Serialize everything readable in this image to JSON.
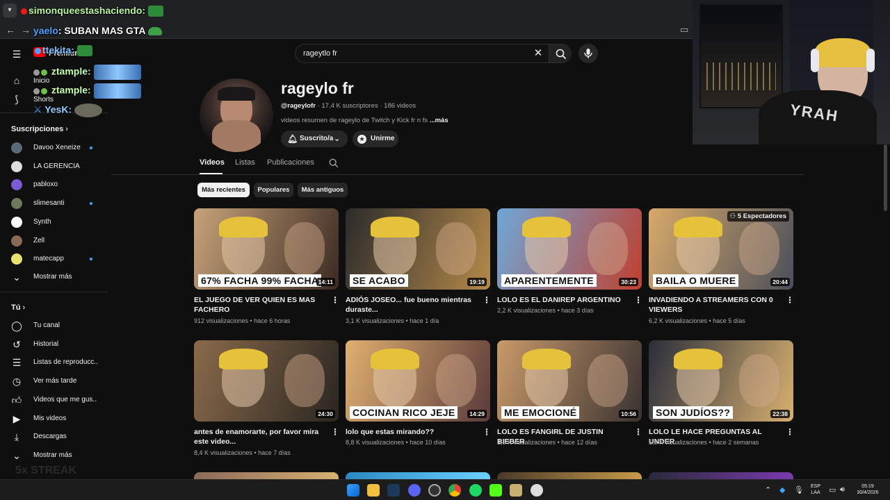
{
  "browser": {
    "tab_dropdown_icon": "chevron-down-icon"
  },
  "chat": [
    {
      "user": "simonqueestashaciendo:",
      "msg": "",
      "color": "#b9f5a0"
    },
    {
      "user": "yaelo",
      "msg": ": SUBAN MAS GTA",
      "color": "#4fa3ff"
    },
    {
      "user": "ttekita:",
      "msg": "",
      "color": "#7fc2ff"
    },
    {
      "user": "ztample:",
      "msg": "",
      "color": "#c8ffb0"
    },
    {
      "user": "ztample:",
      "msg": "",
      "color": "#c8ffb0"
    },
    {
      "user": "YesK:",
      "msg": "",
      "color": "#8fd0ff"
    }
  ],
  "masthead": {
    "premium_label": "Premium",
    "search_value": "rageytlo fr"
  },
  "guide": {
    "main": [
      {
        "label": "Inicio",
        "icon": "home-icon"
      },
      {
        "label": "Shorts",
        "icon": "shorts-icon"
      }
    ],
    "subs_header": "Suscripciones",
    "subscriptions": [
      {
        "label": "Davoo Xeneize",
        "dot": true,
        "color": "#5a6a7a"
      },
      {
        "label": "LA GERENCIA",
        "dot": false,
        "color": "#dddddd"
      },
      {
        "label": "pabloxo",
        "dot": false,
        "color": "#7b5cd6"
      },
      {
        "label": "slimesanti",
        "dot": true,
        "color": "#6b7a5a"
      },
      {
        "label": "Synth",
        "dot": false,
        "color": "#ffffff"
      },
      {
        "label": "Zell",
        "dot": false,
        "color": "#8a6a55"
      },
      {
        "label": "matecapp",
        "dot": true,
        "color": "#e8e070"
      }
    ],
    "subs_more": "Mostrar más",
    "you_header": "Tú",
    "you_items": [
      {
        "label": "Tu canal",
        "icon": "user-icon"
      },
      {
        "label": "Historial",
        "icon": "history-icon"
      },
      {
        "label": "Listas de reproducc...",
        "icon": "playlist-icon"
      },
      {
        "label": "Ver más tarde",
        "icon": "clock-icon"
      },
      {
        "label": "Videos que me gus...",
        "icon": "thumbs-up-icon"
      },
      {
        "label": "Mis videos",
        "icon": "video-icon"
      },
      {
        "label": "Descargas",
        "icon": "download-icon"
      }
    ],
    "you_more": "Mostrar más",
    "streak_text": "5x STREAK"
  },
  "channel": {
    "name": "rageylo fr",
    "handle": "@rageylofr",
    "subscribers": "17,4 K suscriptores",
    "videos_count": "186 videos",
    "description": "videos resumen de rageylo de Twitch y Kick fr n fs",
    "more_link": "...más",
    "subscribed_label": "Suscrito/a",
    "join_label": "Unirme"
  },
  "tabs": [
    "Videos",
    "Listas",
    "Publicaciones"
  ],
  "chips": [
    "Más recientes",
    "Populares",
    "Más antiguos"
  ],
  "videos": [
    {
      "title": "EL JUEGO DE VER QUIEN ES MAS FACHERO",
      "views": "912 visualizaciones",
      "age": "hace 6 horas",
      "duration": "14:11",
      "caption": "67% FACHA   99% FACHA",
      "bg1": "#c8a37a",
      "bg2": "#3a2a22"
    },
    {
      "title": "ADIÓS JOSEO... fue bueno mientras duraste...",
      "views": "3,1 K visualizaciones",
      "age": "hace 1 día",
      "duration": "19:19",
      "caption": "SE ACABO",
      "bg1": "#2b2b2b",
      "bg2": "#b58a4a"
    },
    {
      "title": "LOLO ES EL DANIREP ARGENTINO",
      "views": "2,2 K visualizaciones",
      "age": "hace 3 días",
      "duration": "30:23",
      "caption": "APARENTEMENTE",
      "bg1": "#6fa7d8",
      "bg2": "#c04030"
    },
    {
      "title": "INVADIENDO A STREAMERS CON 0 VIEWERS",
      "views": "6,2 K visualizaciones",
      "age": "hace 5 días",
      "duration": "20:44",
      "caption": "BAILA O MUERE",
      "spectators": "5 Espectadores",
      "bg1": "#d8a96a",
      "bg2": "#4a4f5a"
    },
    {
      "title": "antes de enamorarte, por favor mira este video...",
      "views": "8,4 K visualizaciones",
      "age": "hace 7 días",
      "duration": "24:30",
      "caption": "",
      "bg1": "#8a6a4a",
      "bg2": "#2a2622"
    },
    {
      "title": "lolo que estas mirando??",
      "views": "8,8 K visualizaciones",
      "age": "hace 10 días",
      "duration": "14:29",
      "caption": "COCINAN RICO JEJE",
      "bg1": "#e0b070",
      "bg2": "#5a3a3a"
    },
    {
      "title": "LOLO ES FANGIRL DE JUSTIN BIEBER",
      "views": "3,8 K visualizaciones",
      "age": "hace 12 días",
      "duration": "10:56",
      "caption": "ME EMOCIONÉ",
      "bg1": "#c89a6a",
      "bg2": "#3a3232"
    },
    {
      "title": "LOLO LE HACE PREGUNTAS AL UNDER",
      "views": "5,6 K visualizaciones",
      "age": "hace 2 semanas",
      "duration": "22:38",
      "caption": "SON JUDÍOS??",
      "bg1": "#2a2e3a",
      "bg2": "#d8b070"
    }
  ],
  "taskbar": {
    "lang_line1": "ESP",
    "lang_line2": "LAA",
    "time": "05:19",
    "date": "30/4/2026"
  }
}
